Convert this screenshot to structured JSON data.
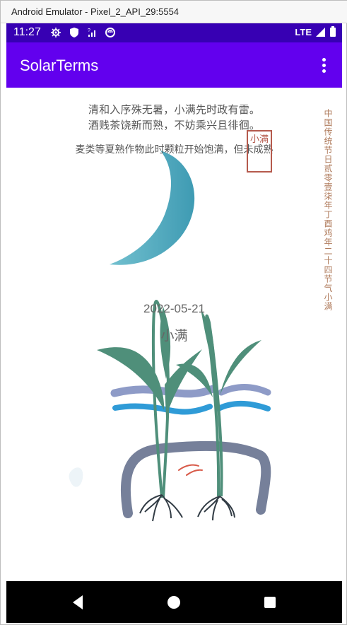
{
  "emulator": {
    "title": "Android Emulator - Pixel_2_API_29:5554"
  },
  "status_bar": {
    "time": "11:27",
    "network": "LTE",
    "icons": [
      "gear-icon",
      "shield-icon",
      "wifi-signal-icon",
      "cast-icon",
      "signal-icon",
      "battery-icon"
    ]
  },
  "app_bar": {
    "title": "SolarTerms",
    "menu_icon": "more-vert-icon"
  },
  "poem": {
    "line1": "清和入序殊无暑，小满先时政有雷。",
    "line2": "酒贱茶饶新而熟，不妨乘兴且徘徊。",
    "description": "麦类等夏熟作物此时颗粒开始饱满，但未成熟"
  },
  "term": {
    "date": "2022-05-21",
    "name": "小满"
  },
  "artwork": {
    "seal_text": "小满",
    "side_text": "中国传统节日贰零壹柒年丁酉鸡年二十四节气小满"
  },
  "colors": {
    "status_bar": "#3700b3",
    "app_bar": "#6200ee",
    "moon": "#5ab4c7",
    "plant": "#4f8f7a",
    "wave_light": "#8e9bc7",
    "wave_blue": "#2f9bd7",
    "pipe": "#76809a"
  },
  "navigation": {
    "back": "back-icon",
    "home": "home-icon",
    "recents": "recents-icon"
  }
}
